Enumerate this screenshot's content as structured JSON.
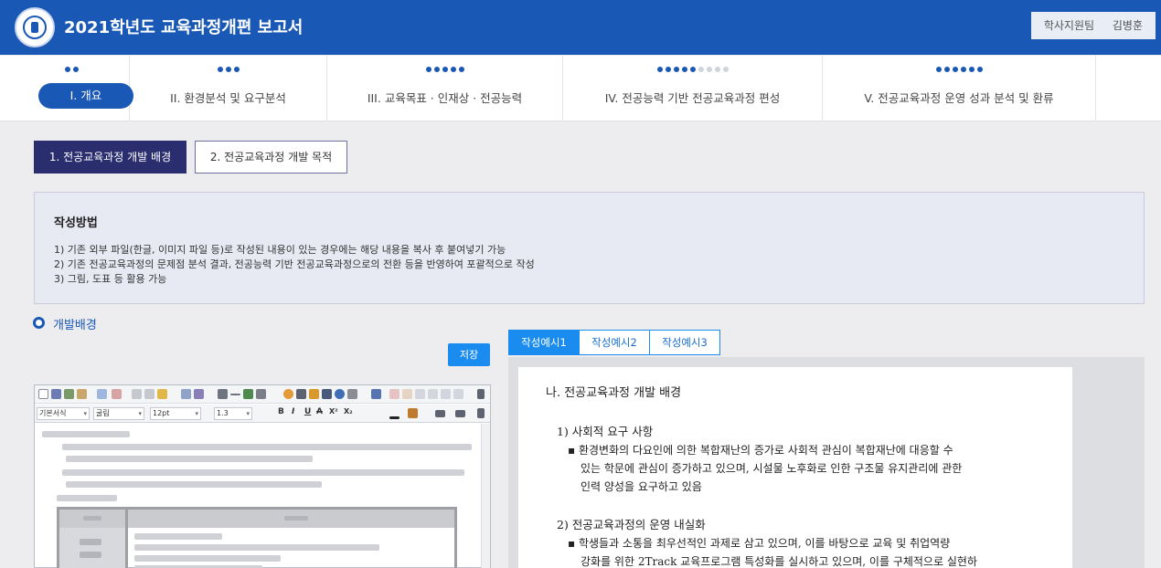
{
  "header": {
    "title": "2021학년도 교육과정개편 보고서",
    "user_dept": "학사지원팀",
    "user_name": "김병훈"
  },
  "steps": [
    {
      "label": "I. 개요",
      "dots_active": 2,
      "dots_total": 2,
      "active": true
    },
    {
      "label": "II. 환경분석 및 요구분석",
      "dots_active": 3,
      "dots_total": 3,
      "active": false
    },
    {
      "label": "III. 교육목표 · 인재상 · 전공능력",
      "dots_active": 5,
      "dots_total": 5,
      "active": false
    },
    {
      "label": "IV. 전공능력 기반 전공교육과정 편성",
      "dots_active": 5,
      "dots_total": 9,
      "active": false
    },
    {
      "label": "V. 전공교육과정 운영 성과 분석 및 환류",
      "dots_active": 6,
      "dots_total": 6,
      "active": false
    }
  ],
  "subtabs": {
    "active": "1. 전공교육과정 개발 배경",
    "inactive": "2. 전공교육과정 개발 목적"
  },
  "guide": {
    "title": "작성방법",
    "lines": [
      "1) 기존 외부 파일(한글, 이미지 파일 등)로 작성된 내용이 있는 경우에는 해당 내용을 복사 후 붙여넣기 가능",
      "2) 기존 전공교육과정의 문제점 분석 결과, 전공능력 기반 전공교육과정으로의 전환 등을 반영하여 포괄적으로 작성",
      "3) 그림, 도표 등 활용 가능"
    ]
  },
  "section": {
    "title": "개발배경",
    "save_label": "저장"
  },
  "editor": {
    "style_select": "기본서식",
    "font_select": "굴림",
    "size_select": "12pt",
    "line_height_select": "1.3",
    "format_bold": "B",
    "format_italic": "I",
    "format_underline": "U",
    "format_strike": "A",
    "format_sup": "X²",
    "format_sub": "X₂"
  },
  "example_tabs": [
    "작성예시1",
    "작성예시2",
    "작성예시3"
  ],
  "example_doc": {
    "heading": "나. 전공교육과정 개발 배경",
    "item1_title": "1) 사회적 요구 사항",
    "item1_line1": "▪ 환경변화의 다요인에 의한 복합재난의 증가로 사회적 관심이 복합재난에 대응할 수",
    "item1_line2": "있는 학문에 관심이 증가하고 있으며, 시설물 노후화로 인한 구조물 유지관리에 관한",
    "item1_line3": "인력 양성을 요구하고 있음",
    "item2_title": "2) 전공교육과정의 운영 내실화",
    "item2_line1": "▪ 학생들과 소통을 최우선적인 과제로 삼고 있으며, 이를 바탕으로 교육 및 취업역량",
    "item2_line2": "강화를 위한 2Track 교육프로그램 특성화를 실시하고 있으며, 이를 구체적으로 실현하"
  },
  "colors": {
    "brand": "#1a58b6",
    "subtab_active": "#2a2d6e",
    "button": "#1a8cf0"
  }
}
